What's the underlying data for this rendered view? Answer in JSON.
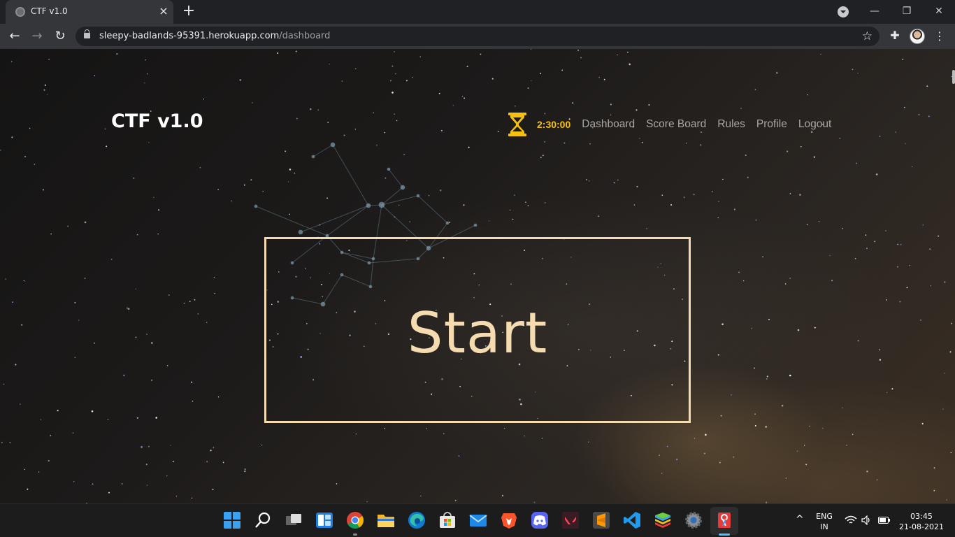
{
  "browser": {
    "tab_title": "CTF v1.0",
    "tab_close": "×",
    "new_tab": "+",
    "url_host": "sleepy-badlands-95391.herokuapp.com",
    "url_path": "/dashboard",
    "window_controls": {
      "minimize": "—",
      "restore": "❐",
      "close": "✕"
    },
    "nav": {
      "back": "←",
      "forward": "→",
      "reload": "↻"
    },
    "star": "☆",
    "menu": "⋮",
    "extensions": "✚"
  },
  "page": {
    "brand": "CTF v1.0",
    "timer": "2:30:00",
    "nav_links": [
      "Dashboard",
      "Score Board",
      "Rules",
      "Profile",
      "Logout"
    ],
    "start_label": "Start",
    "accent_color": "#f5dcb0",
    "timer_color": "#f5c010"
  },
  "taskbar": {
    "language": "ENG",
    "region": "IN",
    "time": "03:45",
    "date": "21-08-2021",
    "tray_chevron": "^",
    "apps": [
      "start-icon",
      "search-icon",
      "task-view-icon",
      "widgets-icon",
      "chrome-icon",
      "file-explorer-icon",
      "edge-icon",
      "store-icon",
      "mail-icon",
      "brave-icon",
      "discord-icon",
      "valorant-icon",
      "sublime-text-icon",
      "vscode-icon",
      "bluestacks-icon",
      "settings-icon",
      "snipping-tool-icon"
    ]
  }
}
